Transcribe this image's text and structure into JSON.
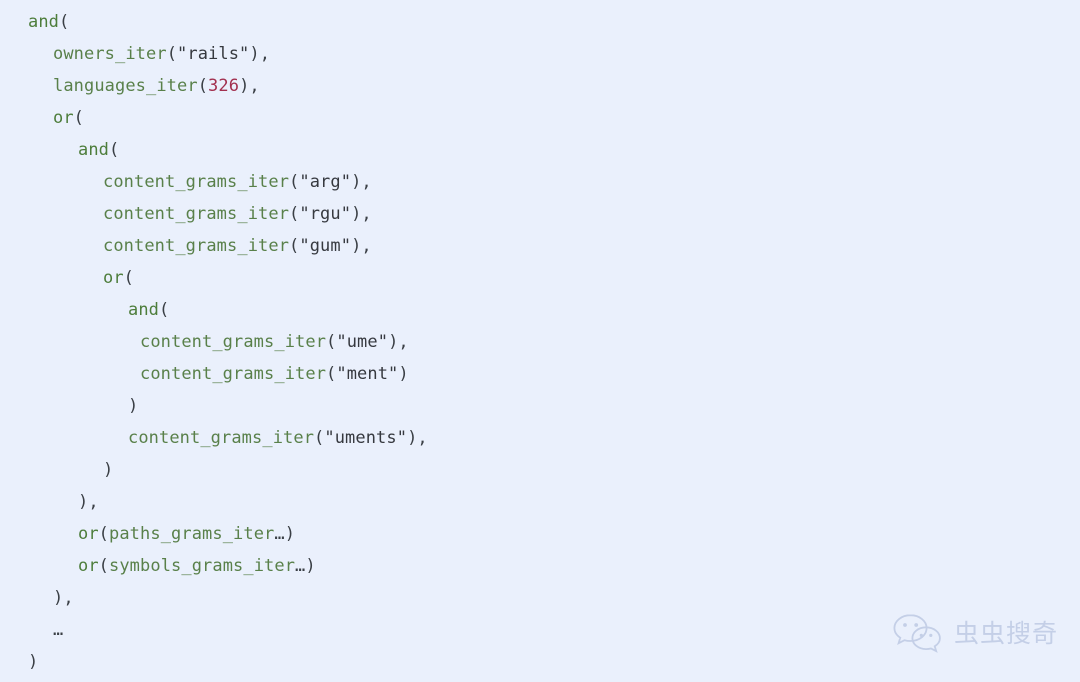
{
  "code": {
    "language": "query-dsl",
    "background_color": "#eaf0fc",
    "colors": {
      "keyword": "#4d7d3b",
      "function": "#59804a",
      "string": "#36393f",
      "number": "#a2304f",
      "punctuation": "#3a3f45"
    },
    "lines": [
      {
        "indent": 0,
        "tokens": [
          {
            "type": "keyword",
            "text": "and"
          },
          {
            "type": "punct",
            "text": "("
          }
        ]
      },
      {
        "indent": 1,
        "tokens": [
          {
            "type": "fn",
            "text": "owners_iter"
          },
          {
            "type": "punct",
            "text": "("
          },
          {
            "type": "str",
            "text": "\"rails\""
          },
          {
            "type": "punct",
            "text": "),"
          }
        ]
      },
      {
        "indent": 1,
        "tokens": [
          {
            "type": "fn",
            "text": "languages_iter"
          },
          {
            "type": "punct",
            "text": "("
          },
          {
            "type": "num",
            "text": "326"
          },
          {
            "type": "punct",
            "text": "),"
          }
        ]
      },
      {
        "indent": 1,
        "tokens": [
          {
            "type": "keyword",
            "text": "or"
          },
          {
            "type": "punct",
            "text": "("
          }
        ]
      },
      {
        "indent": 2,
        "tokens": [
          {
            "type": "keyword",
            "text": "and"
          },
          {
            "type": "punct",
            "text": "("
          }
        ]
      },
      {
        "indent": 3,
        "tokens": [
          {
            "type": "fn",
            "text": "content_grams_iter"
          },
          {
            "type": "punct",
            "text": "("
          },
          {
            "type": "str",
            "text": "\"arg\""
          },
          {
            "type": "punct",
            "text": "),"
          }
        ]
      },
      {
        "indent": 3,
        "tokens": [
          {
            "type": "fn",
            "text": "content_grams_iter"
          },
          {
            "type": "punct",
            "text": "("
          },
          {
            "type": "str",
            "text": "\"rgu\""
          },
          {
            "type": "punct",
            "text": "),"
          }
        ]
      },
      {
        "indent": 3,
        "tokens": [
          {
            "type": "fn",
            "text": "content_grams_iter"
          },
          {
            "type": "punct",
            "text": "("
          },
          {
            "type": "str",
            "text": "\"gum\""
          },
          {
            "type": "punct",
            "text": "),"
          }
        ]
      },
      {
        "indent": 3,
        "tokens": [
          {
            "type": "keyword",
            "text": "or"
          },
          {
            "type": "punct",
            "text": "("
          }
        ]
      },
      {
        "indent": 4,
        "tokens": [
          {
            "type": "keyword",
            "text": "and"
          },
          {
            "type": "punct",
            "text": "("
          }
        ]
      },
      {
        "indent": 5,
        "tokens": [
          {
            "type": "fn",
            "text": "content_grams_iter"
          },
          {
            "type": "punct",
            "text": "("
          },
          {
            "type": "str",
            "text": "\"ume\""
          },
          {
            "type": "punct",
            "text": "),"
          }
        ]
      },
      {
        "indent": 5,
        "tokens": [
          {
            "type": "fn",
            "text": "content_grams_iter"
          },
          {
            "type": "punct",
            "text": "("
          },
          {
            "type": "str",
            "text": "\"ment\""
          },
          {
            "type": "punct",
            "text": ")"
          }
        ]
      },
      {
        "indent": 4,
        "tokens": [
          {
            "type": "punct",
            "text": ")"
          }
        ]
      },
      {
        "indent": 4,
        "tokens": [
          {
            "type": "fn",
            "text": "content_grams_iter"
          },
          {
            "type": "punct",
            "text": "("
          },
          {
            "type": "str",
            "text": "\"uments\""
          },
          {
            "type": "punct",
            "text": "),"
          }
        ]
      },
      {
        "indent": 3,
        "tokens": [
          {
            "type": "punct",
            "text": ")"
          }
        ]
      },
      {
        "indent": 2,
        "tokens": [
          {
            "type": "punct",
            "text": "),"
          }
        ]
      },
      {
        "indent": 2,
        "tokens": [
          {
            "type": "keyword",
            "text": "or"
          },
          {
            "type": "punct",
            "text": "("
          },
          {
            "type": "fn",
            "text": "paths_grams_iter"
          },
          {
            "type": "ellipsis",
            "text": "…"
          },
          {
            "type": "punct",
            "text": ")"
          }
        ]
      },
      {
        "indent": 2,
        "tokens": [
          {
            "type": "keyword",
            "text": "or"
          },
          {
            "type": "punct",
            "text": "("
          },
          {
            "type": "fn",
            "text": "symbols_grams_iter"
          },
          {
            "type": "ellipsis",
            "text": "…"
          },
          {
            "type": "punct",
            "text": ")"
          }
        ]
      },
      {
        "indent": 1,
        "tokens": [
          {
            "type": "punct",
            "text": "),"
          }
        ]
      },
      {
        "indent": 1,
        "tokens": [
          {
            "type": "ellipsis",
            "text": "…"
          }
        ]
      },
      {
        "indent": 0,
        "tokens": [
          {
            "type": "punct",
            "text": ")"
          }
        ]
      }
    ]
  },
  "watermark": {
    "logo_icon": "wechat-logo-icon",
    "text": "虫虫搜奇",
    "color": "#c3cee6"
  }
}
